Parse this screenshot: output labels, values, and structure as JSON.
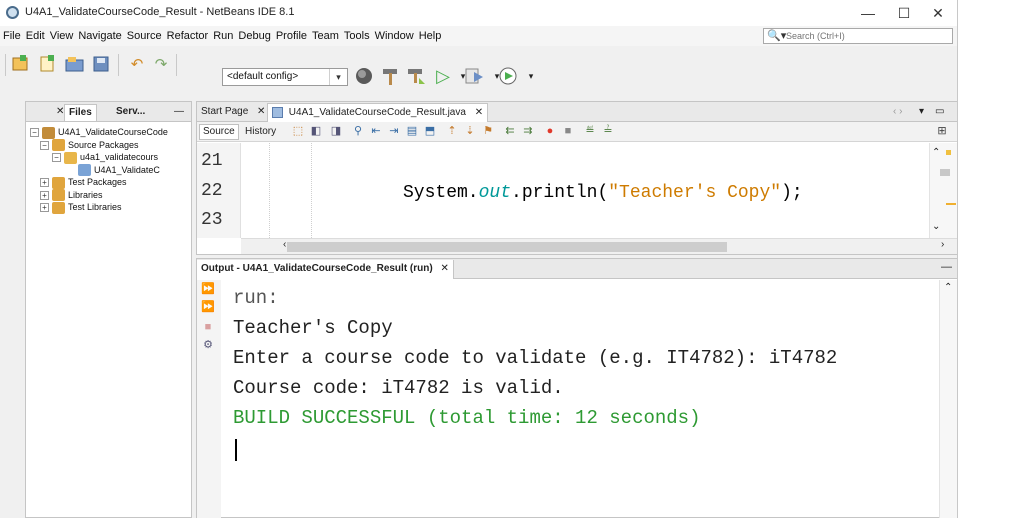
{
  "window": {
    "title": "U4A1_ValidateCourseCode_Result - NetBeans IDE 8.1",
    "controls": {
      "minimize": "—",
      "maximize": "☐",
      "close": "✕"
    }
  },
  "menu": {
    "items": [
      "File",
      "Edit",
      "View",
      "Navigate",
      "Source",
      "Refactor",
      "Run",
      "Debug",
      "Profile",
      "Team",
      "Tools",
      "Window",
      "Help"
    ]
  },
  "search": {
    "placeholder": "Search (Ctrl+I)"
  },
  "toolbar": {
    "config": "<default config>",
    "icons": [
      "new-project-icon",
      "new-file-icon",
      "open-project-icon",
      "save-all-icon",
      "undo-icon",
      "redo-icon",
      "globe-icon",
      "hammer-icon",
      "clean-build-icon",
      "run-icon",
      "debug-icon",
      "profile-icon"
    ]
  },
  "left_panel": {
    "tabs": [
      "Files",
      "Serv..."
    ],
    "tree": [
      {
        "label": "U4A1_ValidateCourseCode",
        "toggle": "−",
        "color": "#c28c3a"
      },
      {
        "label": "Source Packages",
        "toggle": "−",
        "color": "#e0a53d"
      },
      {
        "label": "u4a1_validatecours",
        "toggle": "−",
        "color": "#e8b64a"
      },
      {
        "label": "U4A1_ValidateC",
        "toggle": "",
        "color": "#7aa3d6"
      },
      {
        "label": "Test Packages",
        "toggle": "+",
        "color": "#e0a53d"
      },
      {
        "label": "Libraries",
        "toggle": "+",
        "color": "#e0a53d"
      },
      {
        "label": "Test Libraries",
        "toggle": "+",
        "color": "#e0a53d"
      }
    ]
  },
  "editor": {
    "tabs": [
      "Start Page",
      "U4A1_ValidateCourseCode_Result.java"
    ],
    "view_tabs": [
      "Source",
      "History"
    ],
    "line_numbers": [
      "21",
      "22",
      "23"
    ],
    "code": {
      "prefix": "System.",
      "field": "out",
      "method": ".println(",
      "string": "\"Teacher's Copy\"",
      "suffix": ");"
    }
  },
  "output": {
    "tab": "Output - U4A1_ValidateCourseCode_Result (run)",
    "lines": [
      {
        "text": "run:",
        "style": "gray"
      },
      {
        "text": "Teacher's Copy",
        "style": "normal"
      },
      {
        "text": "Enter a course code to validate (e.g. IT4782): iT4782",
        "style": "normal"
      },
      {
        "text": "Course code: iT4782 is valid.",
        "style": "normal"
      },
      {
        "text": "BUILD SUCCESSFUL (total time: 12 seconds)",
        "style": "green"
      }
    ]
  },
  "colors": {
    "output_success": "#2e9a33",
    "string_literal": "#ce7b00",
    "static_field": "#009999"
  }
}
